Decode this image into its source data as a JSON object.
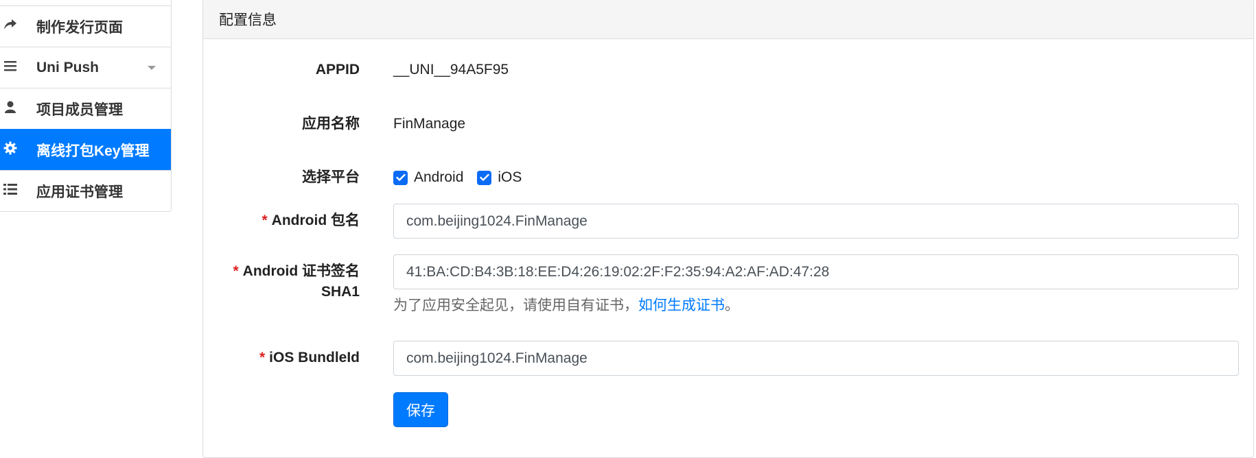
{
  "sidebar": {
    "items": [
      {
        "label": "制作发行页面",
        "icon": "share-arrow-icon"
      },
      {
        "label": "Uni Push",
        "icon": "list-icon"
      },
      {
        "label": "项目成员管理",
        "icon": "user-icon"
      },
      {
        "label": "离线打包Key管理",
        "icon": "gear-icon"
      },
      {
        "label": "应用证书管理",
        "icon": "list-detail-icon"
      }
    ],
    "active_index": 3
  },
  "card": {
    "title": "配置信息"
  },
  "form": {
    "appid_label": "APPID",
    "appid_value": "__UNI__94A5F95",
    "appname_label": "应用名称",
    "appname_value": "FinManage",
    "platform_label": "选择平台",
    "platform_android": "Android",
    "platform_ios": "iOS",
    "required_mark": "*",
    "android_pkg_label": "Android 包名",
    "android_pkg_value": "com.beijing1024.FinManage",
    "android_sha1_label_line1": "Android 证书签名",
    "android_sha1_label_line2": "SHA1",
    "android_sha1_value": "41:BA:CD:B4:3B:18:EE:D4:26:19:02:2F:F2:35:94:A2:AF:AD:47:28",
    "hint_text": "为了应用安全起见，请使用自有证书，",
    "hint_link": "如何生成证书",
    "hint_end": "。",
    "ios_bundle_label": "iOS BundleId",
    "ios_bundle_value": "com.beijing1024.FinManage",
    "save_label": "保存"
  },
  "colors": {
    "accent": "#007bff",
    "required": "#e02020"
  }
}
